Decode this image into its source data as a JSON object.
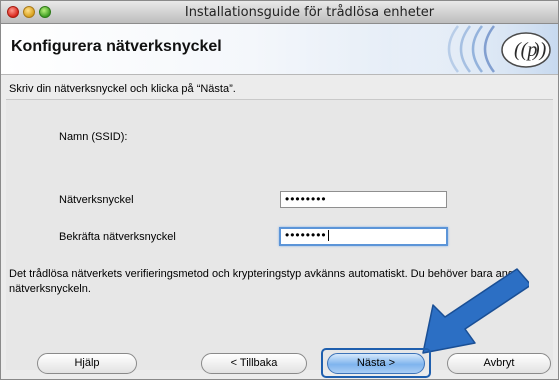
{
  "window": {
    "title": "Installationsguide för trådlösa enheter"
  },
  "banner": {
    "title": "Konfigurera nätverksnyckel"
  },
  "instruction": "Skriv din nätverksnyckel och klicka på “Nästa”.",
  "ssid": {
    "label": "Namn (SSID):"
  },
  "network_key": {
    "label": "Nätverksnyckel",
    "value": "••••••••"
  },
  "confirm_key": {
    "label": "Bekräfta nätverksnyckel",
    "value": "••••••••"
  },
  "note": "Det trådlösa nätverkets verifieringsmetod och krypteringstyp avkänns automatiskt. Du behöver bara ange nätverksnyckeln.",
  "buttons": {
    "help": "Hjälp",
    "back": "< Tillbaka",
    "next": "Nästa >",
    "cancel": "Avbryt"
  },
  "colors": {
    "accent": "#1f5fae",
    "arrow": "#2c6fc4"
  }
}
